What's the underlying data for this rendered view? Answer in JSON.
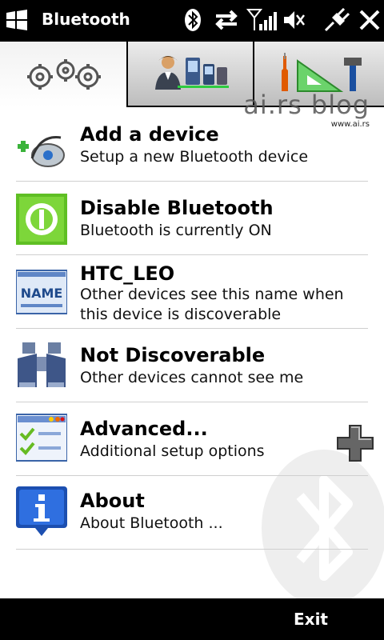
{
  "statusbar": {
    "title": "Bluetooth"
  },
  "watermark": {
    "text": "ai.rs blog",
    "url": "www.ai.rs"
  },
  "items": [
    {
      "label": "Add a device",
      "desc": "Setup a new Bluetooth device"
    },
    {
      "label": "Disable Bluetooth",
      "desc": "Bluetooth is currently ON"
    },
    {
      "label": "HTC_LEO",
      "desc": "Other devices see this name when this device is discoverable",
      "icon_text": "NAME"
    },
    {
      "label": "Not Discoverable",
      "desc": "Other devices cannot see me"
    },
    {
      "label": "Advanced...",
      "desc": "Additional setup options"
    },
    {
      "label": "About",
      "desc": "About Bluetooth ..."
    }
  ],
  "softkey": {
    "right": "Exit"
  }
}
